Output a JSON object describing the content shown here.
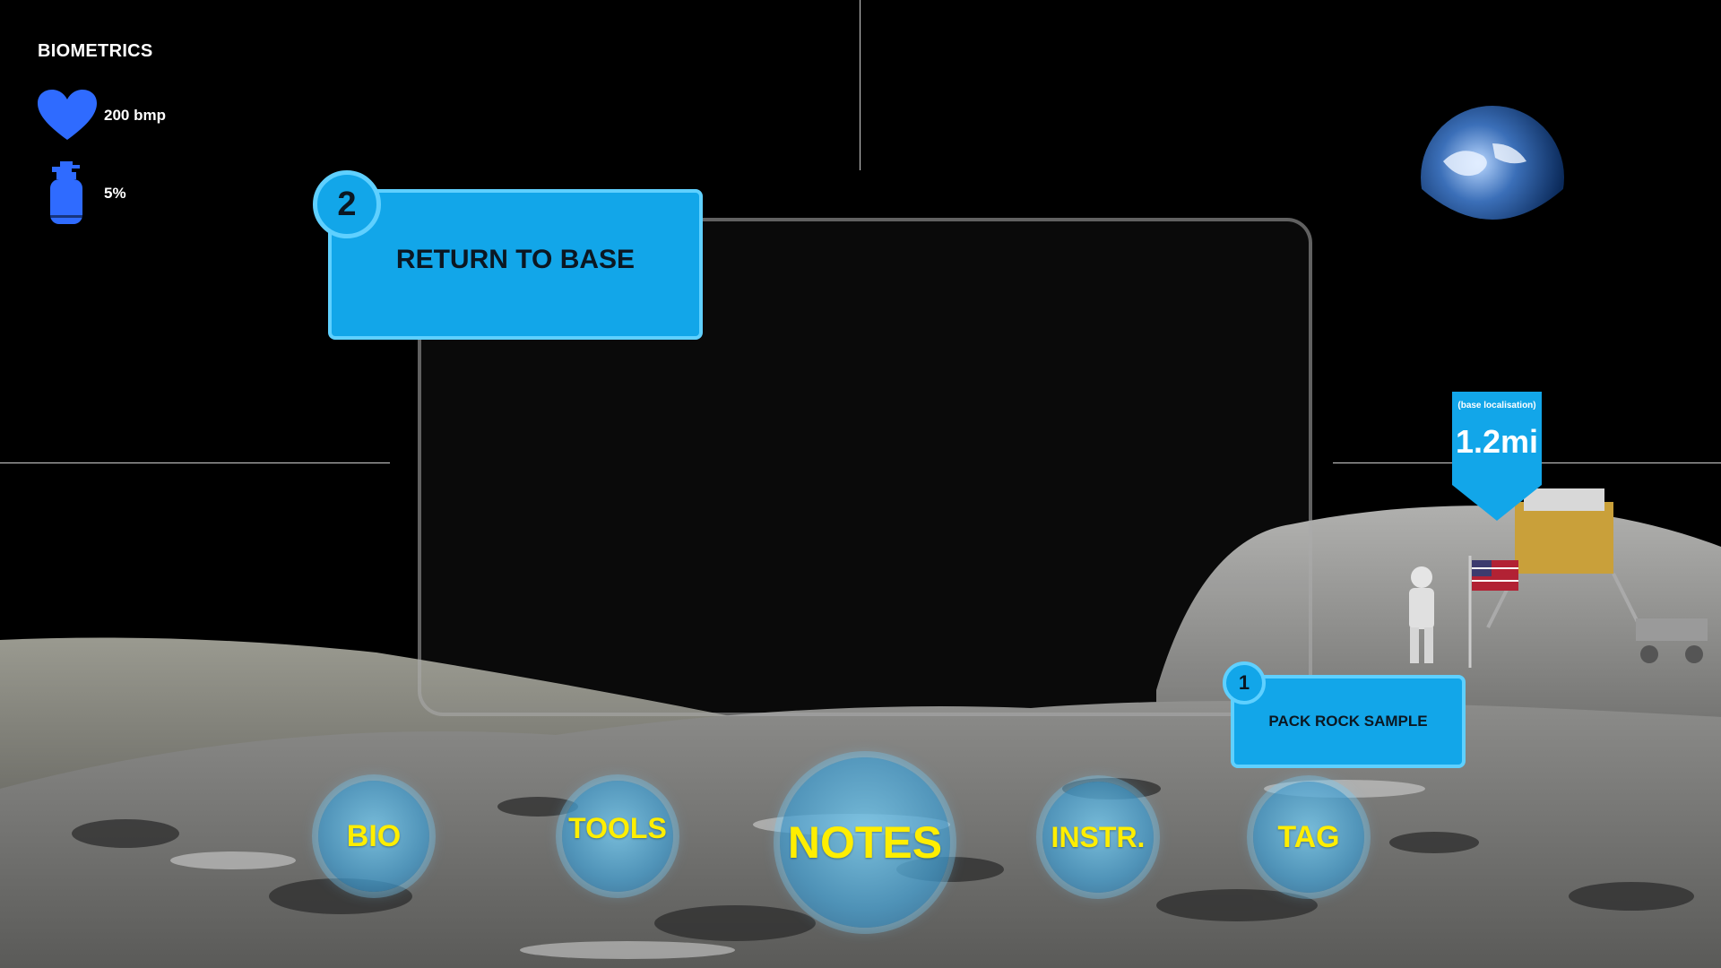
{
  "hud": {
    "title": "BIOMETRICS",
    "heart_rate": "200 bmp",
    "oxygen": "5%",
    "icon_color": "#2f6bff"
  },
  "tasks": [
    {
      "number": "2",
      "label": "RETURN TO BASE"
    },
    {
      "number": "1",
      "label": "PACK ROCK SAMPLE"
    }
  ],
  "marker": {
    "caption": "(base localisation)",
    "distance": "1.2mi"
  },
  "menu": [
    {
      "label": "BIO"
    },
    {
      "label": "TOOLS"
    },
    {
      "label": "NOTES"
    },
    {
      "label": "INSTR."
    },
    {
      "label": "TAG"
    }
  ],
  "colors": {
    "accent": "#12a6e9",
    "accent_border": "#5fd0ff",
    "menu_text": "#ffee00"
  }
}
